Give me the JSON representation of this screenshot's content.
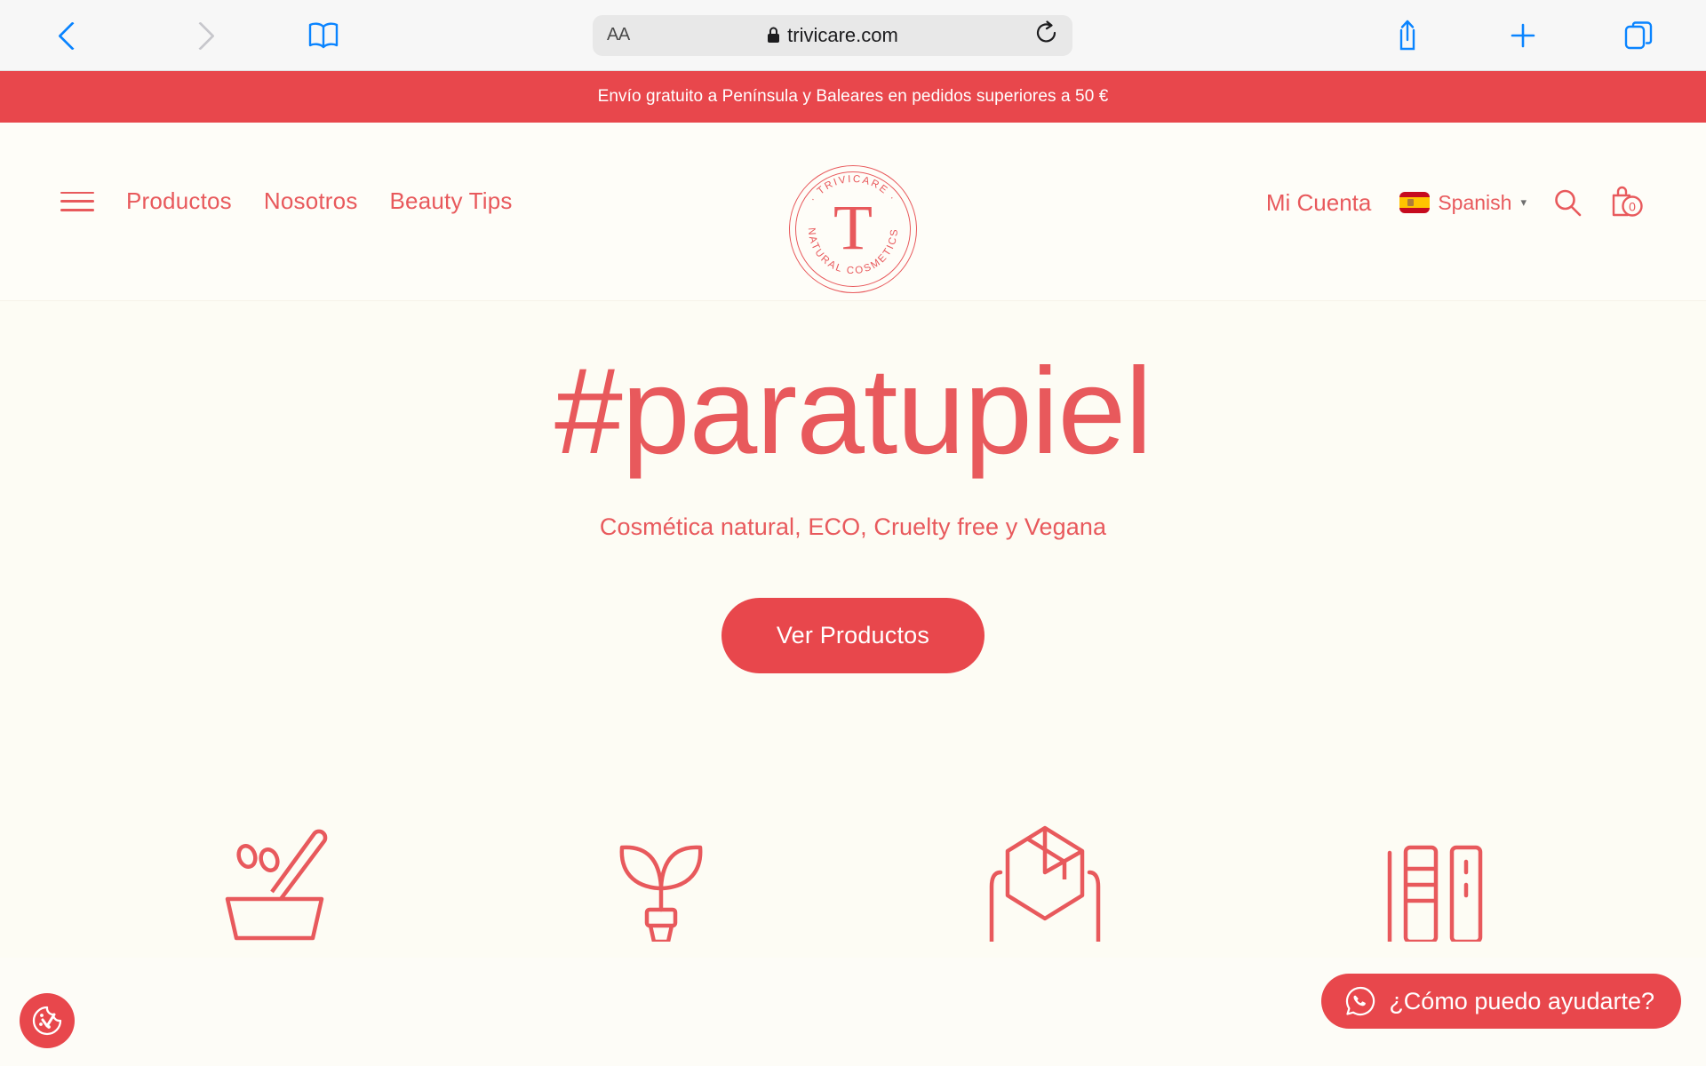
{
  "browser": {
    "back_icon": "chevron-left-icon",
    "forward_icon": "chevron-right-icon",
    "bookmarks_icon": "book-icon",
    "text_size_label": "AA",
    "lock_icon": "lock-icon",
    "url": "trivicare.com",
    "reload_icon": "reload-icon",
    "share_icon": "share-icon",
    "new_tab_icon": "plus-icon",
    "tabs_icon": "tabs-icon"
  },
  "promo": {
    "text": "Envío gratuito a Península y Baleares en pedidos superiores a 50 €",
    "background": "#E8474C",
    "color": "#FFFFFF"
  },
  "header": {
    "menu_icon": "hamburger-menu-icon",
    "nav": [
      {
        "label": "Productos"
      },
      {
        "label": "Nosotros"
      },
      {
        "label": "Beauty Tips"
      }
    ],
    "logo": {
      "top_arc": "· TRIVICARE ·",
      "bottom_arc": "NATURAL COSMETICS",
      "monogram": "T"
    },
    "account_label": "Mi Cuenta",
    "language": {
      "flag": "spain-flag-icon",
      "label": "Spanish",
      "caret": "▾"
    },
    "search_icon": "search-icon",
    "cart_icon": "shopping-bag-icon",
    "cart_count": "0"
  },
  "hero": {
    "title": "#paratupiel",
    "subtitle": "Cosmética natural, ECO, Cruelty free y Vegana",
    "cta_label": "Ver Productos",
    "background": "#FDFCF4"
  },
  "features": [
    {
      "icon": "mortar-pestle-icon"
    },
    {
      "icon": "plant-sprout-icon"
    },
    {
      "icon": "box-in-hands-icon"
    },
    {
      "icon": "product-bottles-icon"
    }
  ],
  "widgets": {
    "cookie_icon": "cookie-consent-icon",
    "whatsapp_icon": "whatsapp-icon",
    "whatsapp_label": "¿Cómo puedo ayudarte?"
  },
  "theme": {
    "brand_red": "#E8474C",
    "brand_red_light": "#E8595C",
    "page_background": "#FDFCF4"
  }
}
